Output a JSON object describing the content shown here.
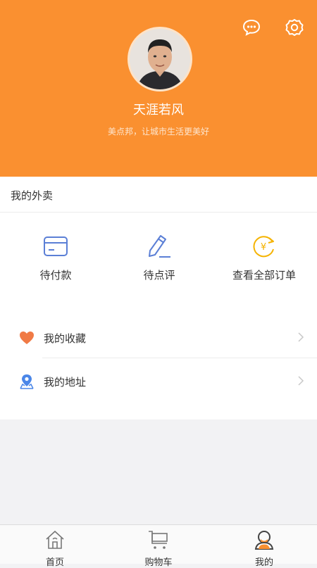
{
  "header": {
    "background_color": "#fa9030",
    "message_icon": "chat-bubble-icon",
    "settings_icon": "gear-icon",
    "username": "天涯若风",
    "slogan": "美点邦，让城市生活更美好"
  },
  "section": {
    "title": "我的外卖"
  },
  "orders": [
    {
      "label": "待付款",
      "icon": "card-icon"
    },
    {
      "label": "待点评",
      "icon": "pen-icon"
    },
    {
      "label": "查看全部订单",
      "icon": "yen-refresh-icon"
    }
  ],
  "list": [
    {
      "label": "我的收藏",
      "icon": "heart-icon"
    },
    {
      "label": "我的地址",
      "icon": "location-pin-icon"
    }
  ],
  "tabbar": {
    "tabs": [
      {
        "label": "首页",
        "icon": "home-icon"
      },
      {
        "label": "购物车",
        "icon": "cart-icon"
      },
      {
        "label": "我的",
        "icon": "user-icon",
        "active": true
      }
    ]
  },
  "colors": {
    "accent": "#fa9030",
    "icon_blue": "#5b7fd6",
    "icon_yellow": "#f5b300",
    "heart": "#f07a45"
  }
}
